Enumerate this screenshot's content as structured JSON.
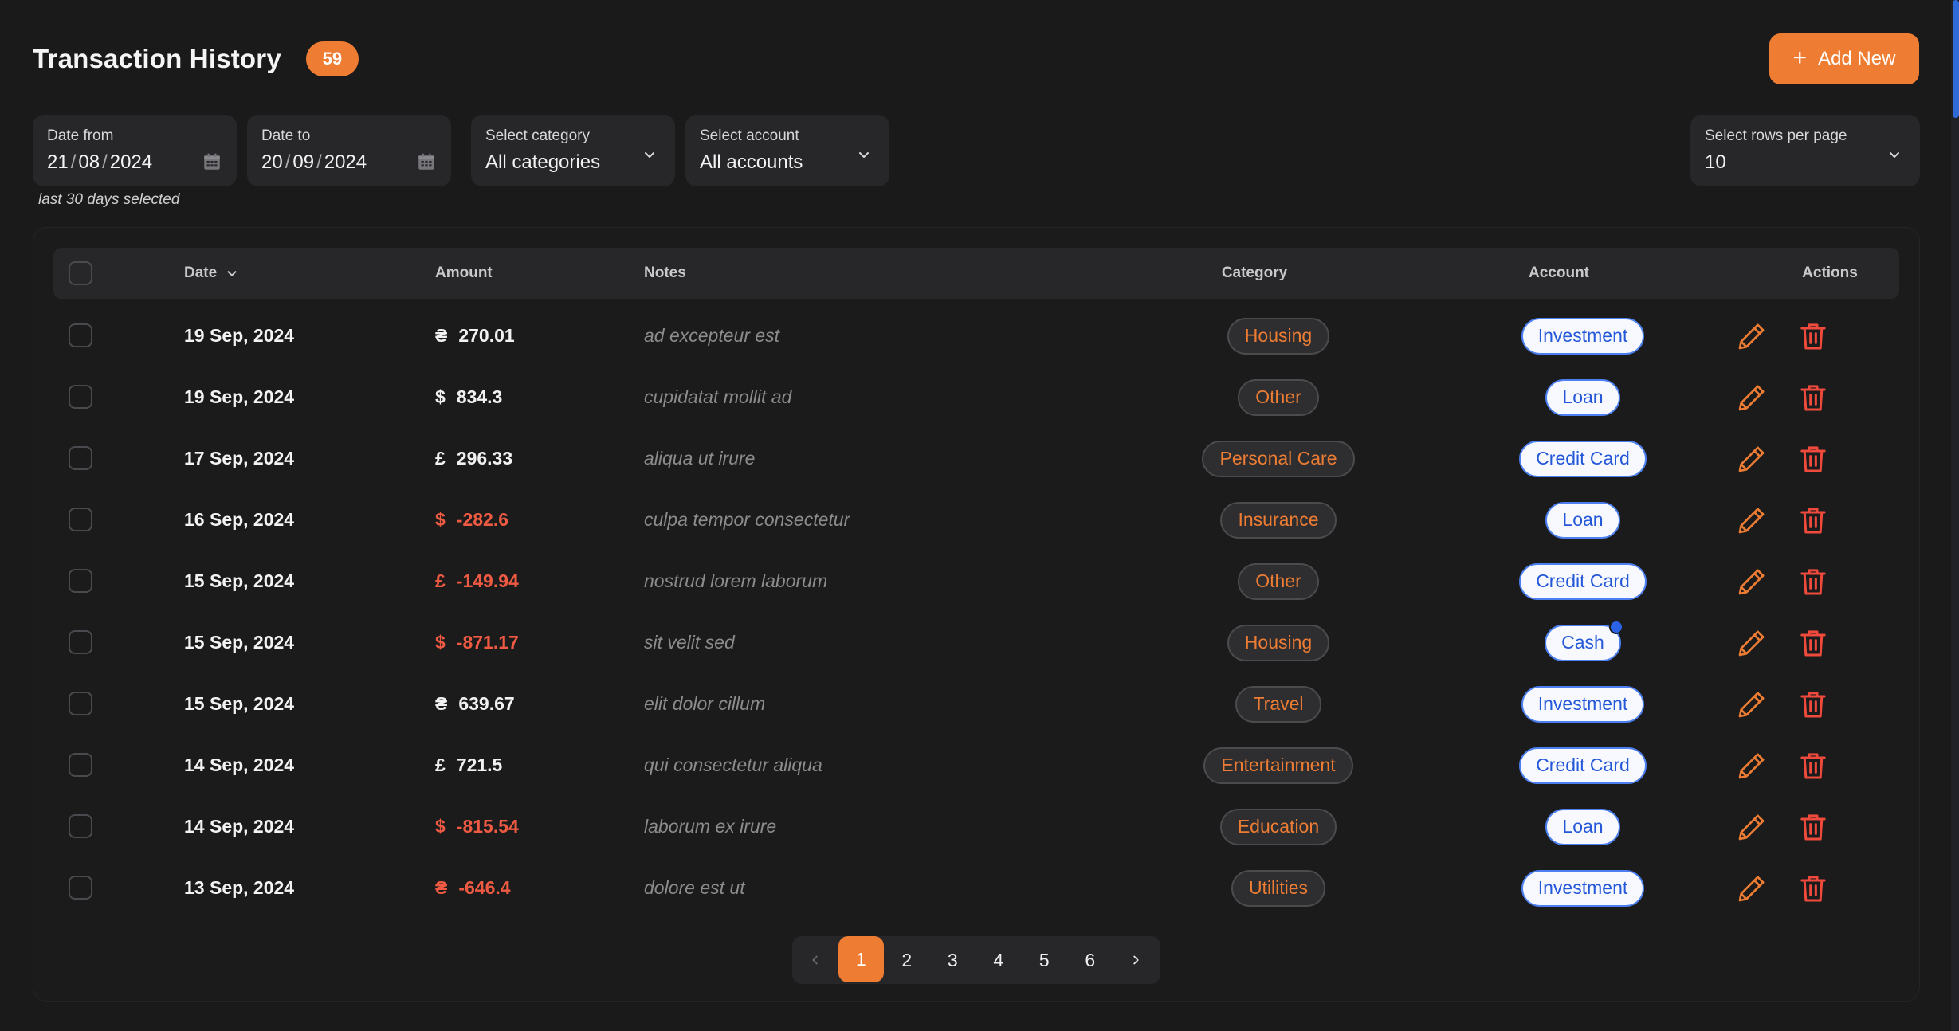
{
  "header": {
    "title": "Transaction History",
    "count": "59",
    "add_label": "Add New"
  },
  "filters": {
    "date_from": {
      "label": "Date from",
      "day": "21",
      "month": "08",
      "year": "2024"
    },
    "date_to": {
      "label": "Date to",
      "day": "20",
      "month": "09",
      "year": "2024"
    },
    "date_sep": "/",
    "category": {
      "label": "Select category",
      "value": "All categories"
    },
    "account": {
      "label": "Select account",
      "value": "All accounts"
    },
    "rows_per_page": {
      "label": "Select rows per page",
      "value": "10"
    },
    "hint": "last 30 days selected"
  },
  "table": {
    "columns": {
      "date": "Date",
      "amount": "Amount",
      "notes": "Notes",
      "category": "Category",
      "account": "Account",
      "actions": "Actions"
    },
    "rows": [
      {
        "date": "19 Sep, 2024",
        "currency": "₴",
        "amount": "270.01",
        "negative": false,
        "notes": "ad excepteur est",
        "category": "Housing",
        "account": "Investment",
        "dot": false
      },
      {
        "date": "19 Sep, 2024",
        "currency": "$",
        "amount": "834.3",
        "negative": false,
        "notes": "cupidatat mollit ad",
        "category": "Other",
        "account": "Loan",
        "dot": false
      },
      {
        "date": "17 Sep, 2024",
        "currency": "£",
        "amount": "296.33",
        "negative": false,
        "notes": "aliqua ut irure",
        "category": "Personal Care",
        "account": "Credit Card",
        "dot": false
      },
      {
        "date": "16 Sep, 2024",
        "currency": "$",
        "amount": "-282.6",
        "negative": true,
        "notes": "culpa tempor consectetur",
        "category": "Insurance",
        "account": "Loan",
        "dot": false
      },
      {
        "date": "15 Sep, 2024",
        "currency": "£",
        "amount": "-149.94",
        "negative": true,
        "notes": "nostrud lorem laborum",
        "category": "Other",
        "account": "Credit Card",
        "dot": false
      },
      {
        "date": "15 Sep, 2024",
        "currency": "$",
        "amount": "-871.17",
        "negative": true,
        "notes": "sit velit sed",
        "category": "Housing",
        "account": "Cash",
        "dot": true
      },
      {
        "date": "15 Sep, 2024",
        "currency": "₴",
        "amount": "639.67",
        "negative": false,
        "notes": "elit dolor cillum",
        "category": "Travel",
        "account": "Investment",
        "dot": false
      },
      {
        "date": "14 Sep, 2024",
        "currency": "£",
        "amount": "721.5",
        "negative": false,
        "notes": "qui consectetur aliqua",
        "category": "Entertainment",
        "account": "Credit Card",
        "dot": false
      },
      {
        "date": "14 Sep, 2024",
        "currency": "$",
        "amount": "-815.54",
        "negative": true,
        "notes": "laborum ex irure",
        "category": "Education",
        "account": "Loan",
        "dot": false
      },
      {
        "date": "13 Sep, 2024",
        "currency": "₴",
        "amount": "-646.4",
        "negative": true,
        "notes": "dolore est ut",
        "category": "Utilities",
        "account": "Investment",
        "dot": false
      }
    ]
  },
  "pagination": {
    "pages": [
      "1",
      "2",
      "3",
      "4",
      "5",
      "6"
    ],
    "current": "1",
    "prev_icon": "chevron-left-icon",
    "next_icon": "chevron-right-icon"
  },
  "colors": {
    "accent": "#ee7d33",
    "negative": "#ef5a43",
    "account_blue": "#2458d8",
    "background": "#1a1a1b"
  }
}
